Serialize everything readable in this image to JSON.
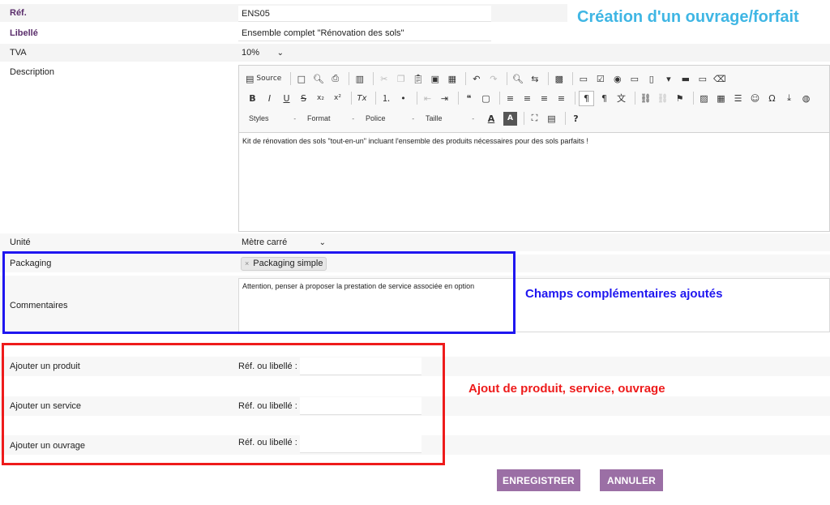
{
  "header": {
    "title": "Création d'un ouvrage/forfait"
  },
  "form": {
    "ref": {
      "label": "Réf.",
      "value": "ENS05"
    },
    "libelle": {
      "label": "Libellé",
      "value": "Ensemble complet \"Rénovation des sols\""
    },
    "tva": {
      "label": "TVA",
      "value": "10%"
    },
    "description": {
      "label": "Description",
      "content": "Kit de rénovation des sols \"tout-en-un\" incluant l'ensemble des produits nécessaires pour des sols parfaits !"
    },
    "unite": {
      "label": "Unité",
      "value": "Mètre carré"
    },
    "packaging": {
      "label": "Packaging",
      "chip": "Packaging simple",
      "chip_remove": "×"
    },
    "commentaires": {
      "label": "Commentaires",
      "value": "Attention, penser à proposer la prestation de service associée en option"
    }
  },
  "editor": {
    "source_label": "Source",
    "combos": {
      "styles": "Styles",
      "format": "Format",
      "police": "Police",
      "taille": "Taille"
    },
    "combo_arrow": "-",
    "icons": {
      "source": "▤",
      "new_page": "□",
      "preview": "🔍︎",
      "print": "⎙",
      "templates": "▥",
      "cut": "✂",
      "copy": "❐",
      "paste": "📋︎",
      "paste_text": "▣",
      "paste_word": "▦",
      "undo": "↶",
      "redo": "↷",
      "find": "🔍︎",
      "replace": "⇆",
      "select_all": "▩",
      "form": "▭",
      "checkbox": "☑",
      "radio": "◉",
      "textfield": "▭",
      "textarea": "▯",
      "select": "▾",
      "button": "▬",
      "imagebutton": "▭",
      "hidden": "⌫",
      "bold": "B",
      "italic": "I",
      "underline": "U",
      "strike": "S",
      "subscript": "x₂",
      "superscript": "x²",
      "remove_format": "Tx",
      "numbered_list": "⒈",
      "bullet_list": "•",
      "outdent": "⇤",
      "indent": "⇥",
      "blockquote": "❝",
      "div": "▢",
      "align_left": "≡",
      "align_center": "≡",
      "align_right": "≡",
      "justify": "≡",
      "ltr": "¶",
      "rtl": "¶",
      "language": "文",
      "link": "⛓",
      "unlink": "⛓",
      "anchor": "⚑",
      "image": "▨",
      "table": "▦",
      "hr": "☰",
      "smiley": "☺",
      "special_char": "Ω",
      "page_break": "⤓",
      "iframe": "◍",
      "text_color": "A",
      "bg_color": "A",
      "maximize": "⛶",
      "show_blocks": "▤",
      "about": "?"
    }
  },
  "annotations": {
    "blue": "Champs complémentaires ajoutés",
    "red": "Ajout de produit, service, ouvrage"
  },
  "add_items": [
    {
      "label": "Ajouter un produit",
      "ref_label": "Réf. ou libellé :"
    },
    {
      "label": "Ajouter un service",
      "ref_label": "Réf. ou libellé :"
    },
    {
      "label": "Ajouter un ouvrage",
      "ref_label": "Réf. ou libellé :"
    }
  ],
  "buttons": {
    "save": "ENREGISTRER",
    "cancel": "ANNULER"
  },
  "colors": {
    "title": "#3fb6e4",
    "annotation_blue": "#1f16f0",
    "annotation_red": "#ee1b1b",
    "button_bg": "#9b6fa5",
    "label_accent": "#5a2d6b"
  }
}
